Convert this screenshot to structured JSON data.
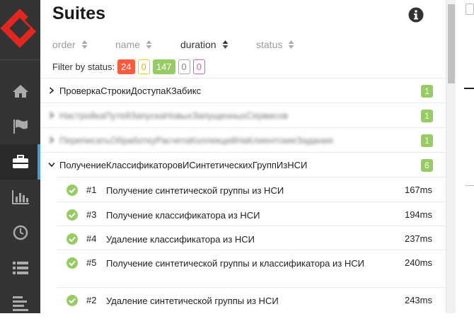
{
  "header": {
    "title": "Suites"
  },
  "sort": {
    "order": "order",
    "name": "name",
    "duration": "duration",
    "status": "status"
  },
  "filter": {
    "label": "Filter by status:",
    "failed": "24",
    "broken": "0",
    "passed": "147",
    "skipped": "0",
    "unknown": "0"
  },
  "suites": [
    {
      "name": "ПроверкаСтрокиДоступаКЗабикс",
      "count": "1"
    },
    {
      "name": "НастройкаПутейЗапускаНовыхЗапущенныхСервисов",
      "count": "1"
    },
    {
      "name": "ПереписатьОбработкуРасчетаКоллекцийНаКлиентскиеЗадания",
      "count": "1"
    },
    {
      "name": "ПолучениеКлассификаторовИСинтетическихГруппИзНСИ",
      "count": "6"
    }
  ],
  "cases": [
    {
      "num": "#1",
      "name": "Получение синтетической группы из НСИ",
      "duration": "167ms"
    },
    {
      "num": "#3",
      "name": "Получение классификатора из НСИ",
      "duration": "194ms"
    },
    {
      "num": "#4",
      "name": "Удаление классификатора из НСИ",
      "duration": "237ms"
    },
    {
      "num": "#5",
      "name": "Получение синтетической группы и классификатора из НСИ",
      "duration": "240ms"
    },
    {
      "num": "#2",
      "name": "Удаление синтетической группы из НСИ",
      "duration": "243ms"
    }
  ],
  "colors": {
    "sidebar": "#343434",
    "accent": "#4b9ad6",
    "failed": "#fd5a3e",
    "passed": "#97cc64",
    "broken": "#e0d300",
    "unknown": "#d35ebe"
  },
  "icons": [
    "allure-logo",
    "home-icon",
    "flag-icon",
    "briefcase-icon",
    "bar-chart-icon",
    "clock-icon",
    "list-icon",
    "align-left-icon",
    "info-icon"
  ]
}
